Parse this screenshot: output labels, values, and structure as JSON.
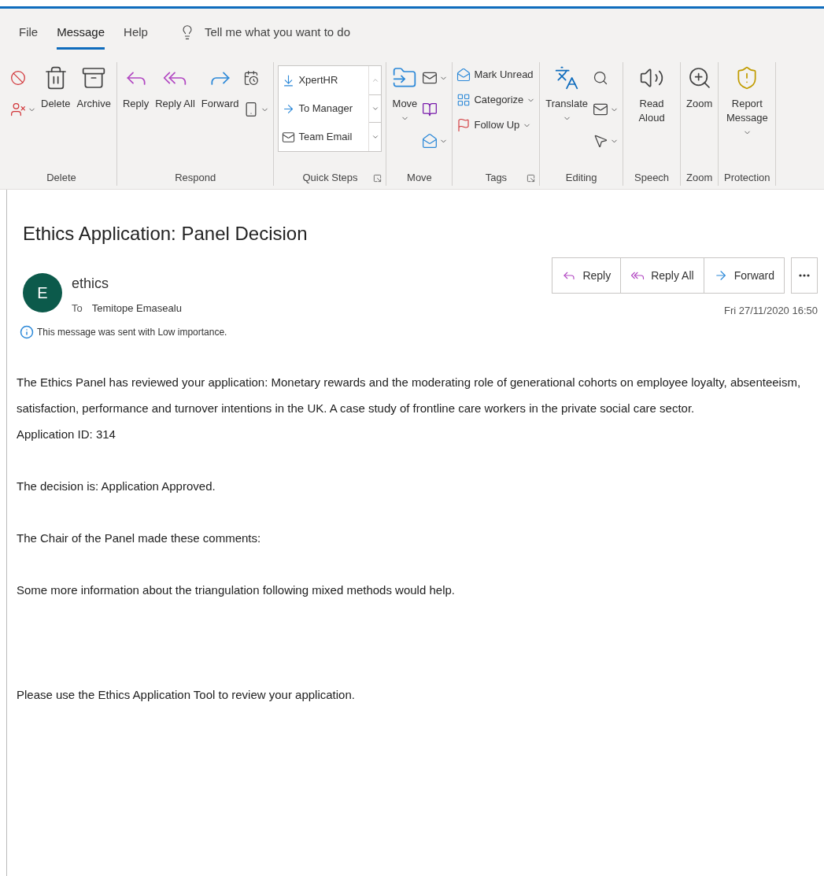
{
  "tabs": [
    {
      "label": "File",
      "selected": false
    },
    {
      "label": "Message",
      "selected": true
    },
    {
      "label": "Help",
      "selected": false
    }
  ],
  "tell_me": {
    "placeholder": "Tell me what you want to do"
  },
  "ribbon": {
    "groups": [
      {
        "label": "Delete",
        "launcher": false,
        "columns": [
          [
            {
              "kind": "icon",
              "dropdown": false
            },
            {
              "kind": "icon",
              "dropdown": true
            }
          ],
          [
            {
              "kind": "large",
              "label": "Delete",
              "dropdown": false
            }
          ],
          [
            {
              "kind": "large",
              "label": "Archive",
              "dropdown": false
            }
          ]
        ]
      },
      {
        "label": "Respond",
        "launcher": false,
        "columns": [
          [
            {
              "kind": "large",
              "label": "Reply",
              "dropdown": false
            }
          ],
          [
            {
              "kind": "large",
              "label": "Reply All",
              "dropdown": false
            }
          ],
          [
            {
              "kind": "large",
              "label": "Forward",
              "dropdown": false
            }
          ],
          [
            {
              "kind": "icon",
              "dropdown": false
            },
            {
              "kind": "icon",
              "dropdown": true
            }
          ]
        ]
      },
      {
        "label": "Quick Steps",
        "launcher": true,
        "columns": [
          [
            {
              "kind": "gallery",
              "items": [
                "XpertHR",
                "To Manager",
                "Team Email"
              ]
            }
          ]
        ]
      },
      {
        "label": "Move",
        "launcher": false,
        "columns": [
          [
            {
              "kind": "large",
              "label": "Move",
              "dropdown": true
            }
          ],
          [
            {
              "kind": "icon",
              "dropdown": true
            },
            {
              "kind": "icon",
              "dropdown": false
            },
            {
              "kind": "icon",
              "dropdown": true
            }
          ]
        ]
      },
      {
        "label": "Tags",
        "launcher": true,
        "columns": [
          [
            {
              "kind": "small",
              "label": "Mark Unread",
              "dropdown": false
            },
            {
              "kind": "small",
              "label": "Categorize",
              "dropdown": true
            },
            {
              "kind": "small",
              "label": "Follow Up",
              "dropdown": true
            }
          ]
        ]
      },
      {
        "label": "Editing",
        "launcher": false,
        "columns": [
          [
            {
              "kind": "large",
              "label": "Translate",
              "dropdown": true
            }
          ],
          [
            {
              "kind": "icon",
              "dropdown": false
            },
            {
              "kind": "icon",
              "dropdown": true
            },
            {
              "kind": "icon",
              "dropdown": true
            }
          ]
        ]
      },
      {
        "label": "Speech",
        "launcher": false,
        "columns": [
          [
            {
              "kind": "large",
              "label": "Read Aloud",
              "dropdown": false
            }
          ]
        ]
      },
      {
        "label": "Zoom",
        "launcher": false,
        "columns": [
          [
            {
              "kind": "large",
              "label": "Zoom",
              "dropdown": false
            }
          ]
        ]
      },
      {
        "label": "Protection",
        "launcher": false,
        "columns": [
          [
            {
              "kind": "large",
              "label": "Report Message",
              "dropdown": true
            }
          ]
        ]
      }
    ]
  },
  "message": {
    "subject": "Ethics Application: Panel Decision",
    "sender": {
      "initial": "E",
      "name": "ethics"
    },
    "to_label": "To",
    "recipient": "Temitope Emasealu",
    "actions": [
      "Reply",
      "Reply All",
      "Forward"
    ],
    "date": "Fri 27/11/2020 16:50",
    "importance_note": "This message was sent with Low importance.",
    "body": [
      [
        "The Ethics Panel has reviewed your application: Monetary rewards and the moderating role of generational cohorts on employee loyalty, absenteeism, satisfaction, performance and turnover intentions in the UK. A case study of frontline care workers in the private social care sector.",
        "Application ID: 314"
      ],
      [
        "The decision is: Application Approved."
      ],
      [
        "The Chair of the Panel made these comments:"
      ],
      [
        "Some more information about the triangulation following mixed methods would help."
      ],
      [
        "Please use the Ethics Application Tool to review your application."
      ]
    ]
  }
}
